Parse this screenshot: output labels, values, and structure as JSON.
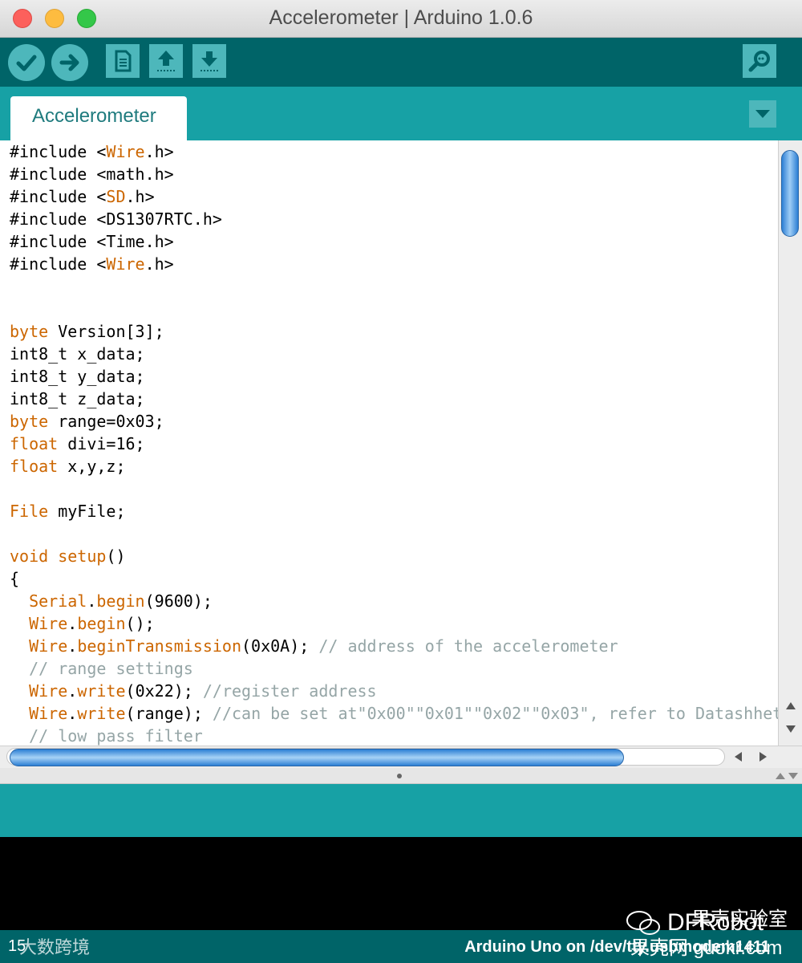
{
  "window": {
    "title": "Accelerometer | Arduino 1.0.6"
  },
  "toolbar": {
    "buttons": [
      {
        "icon": "checkmark-icon",
        "action": "verify"
      },
      {
        "icon": "arrow-right-icon",
        "action": "upload"
      },
      {
        "icon": "new-file-icon",
        "action": "new"
      },
      {
        "icon": "arrow-up-icon",
        "action": "open"
      },
      {
        "icon": "arrow-down-icon",
        "action": "save"
      },
      {
        "icon": "magnifier-icon",
        "action": "serial-monitor"
      }
    ]
  },
  "tabs": {
    "active": "Accelerometer"
  },
  "editor": {
    "lines": [
      [
        {
          "t": "#include <"
        },
        {
          "t": "Wire",
          "c": "kw"
        },
        {
          "t": ".h>"
        }
      ],
      [
        {
          "t": "#include <math.h>"
        }
      ],
      [
        {
          "t": "#include <"
        },
        {
          "t": "SD",
          "c": "kw"
        },
        {
          "t": ".h>"
        }
      ],
      [
        {
          "t": "#include <DS1307RTC.h>"
        }
      ],
      [
        {
          "t": "#include <Time.h>"
        }
      ],
      [
        {
          "t": "#include <"
        },
        {
          "t": "Wire",
          "c": "kw"
        },
        {
          "t": ".h>"
        }
      ],
      [],
      [],
      [
        {
          "t": "byte",
          "c": "kw"
        },
        {
          "t": " Version[3];"
        }
      ],
      [
        {
          "t": "int8_t x_data;"
        }
      ],
      [
        {
          "t": "int8_t y_data;"
        }
      ],
      [
        {
          "t": "int8_t z_data;"
        }
      ],
      [
        {
          "t": "byte",
          "c": "kw"
        },
        {
          "t": " range=0x03;"
        }
      ],
      [
        {
          "t": "float",
          "c": "kw"
        },
        {
          "t": " divi=16;"
        }
      ],
      [
        {
          "t": "float",
          "c": "kw"
        },
        {
          "t": " x,y,z;"
        }
      ],
      [],
      [
        {
          "t": "File",
          "c": "kw"
        },
        {
          "t": " myFile;"
        }
      ],
      [],
      [
        {
          "t": "void",
          "c": "kw"
        },
        {
          "t": " "
        },
        {
          "t": "setup",
          "c": "kw"
        },
        {
          "t": "()"
        }
      ],
      [
        {
          "t": "{"
        }
      ],
      [
        {
          "t": "  "
        },
        {
          "t": "Serial",
          "c": "kw"
        },
        {
          "t": "."
        },
        {
          "t": "begin",
          "c": "kw"
        },
        {
          "t": "(9600);"
        }
      ],
      [
        {
          "t": "  "
        },
        {
          "t": "Wire",
          "c": "kw"
        },
        {
          "t": "."
        },
        {
          "t": "begin",
          "c": "kw"
        },
        {
          "t": "();"
        }
      ],
      [
        {
          "t": "  "
        },
        {
          "t": "Wire",
          "c": "kw"
        },
        {
          "t": "."
        },
        {
          "t": "beginTransmission",
          "c": "kw"
        },
        {
          "t": "(0x0A); "
        },
        {
          "t": "// address of the accelerometer",
          "c": "cm"
        }
      ],
      [
        {
          "t": "  "
        },
        {
          "t": "// range settings",
          "c": "cm"
        }
      ],
      [
        {
          "t": "  "
        },
        {
          "t": "Wire",
          "c": "kw"
        },
        {
          "t": "."
        },
        {
          "t": "write",
          "c": "kw"
        },
        {
          "t": "(0x22); "
        },
        {
          "t": "//register address",
          "c": "cm"
        }
      ],
      [
        {
          "t": "  "
        },
        {
          "t": "Wire",
          "c": "kw"
        },
        {
          "t": "."
        },
        {
          "t": "write",
          "c": "kw"
        },
        {
          "t": "(range); "
        },
        {
          "t": "//can be set at\"0x00\"\"0x01\"\"0x02\"\"0x03\", refer to Datashhet",
          "c": "cm"
        }
      ],
      [
        {
          "t": "  "
        },
        {
          "t": "// low pass filter",
          "c": "cm"
        }
      ]
    ]
  },
  "statusbar": {
    "line": "15",
    "board": "Arduino Uno on /dev/tty.usbmodem1411"
  },
  "watermark": {
    "left": "大数跨境",
    "right_top": "果壳实验室",
    "right_brand": "DFRobot",
    "right_bottom": "果壳网 guokr.com"
  },
  "colors": {
    "toolbar": "#006468",
    "tabbar": "#17a1a5",
    "button": "#4db7bb",
    "keyword": "#cc6600",
    "comment": "#95a5a6"
  }
}
